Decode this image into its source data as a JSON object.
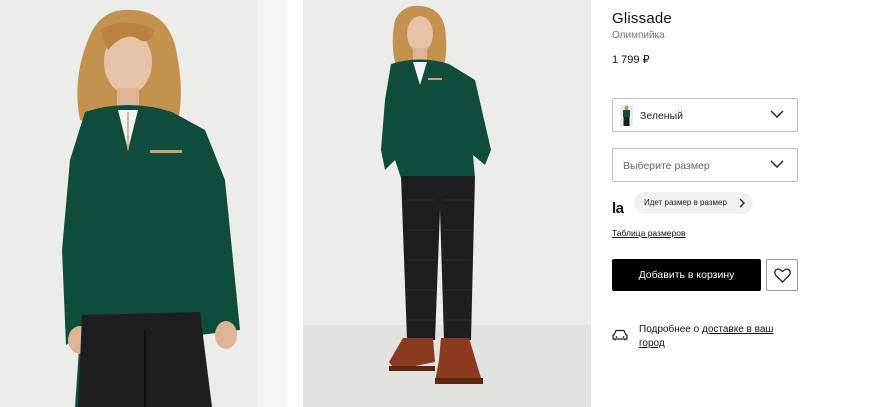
{
  "photos": [
    {
      "alt": "product-photo-front-closeup"
    },
    {
      "alt": "product-photo-full-length"
    }
  ],
  "product": {
    "brand": "Glissade",
    "type": "Олимпийка",
    "price": "1 799 ₽"
  },
  "color_select": {
    "value": "Зеленый"
  },
  "size_select": {
    "placeholder": "Выберите размер"
  },
  "fit": {
    "logo": "la",
    "label": "Идет размер в размер"
  },
  "size_table_link": "Таблица размеров",
  "cart_button": "Добавить в корзину",
  "delivery": {
    "prefix": "Подробнее о ",
    "link": "доставке в ваш город"
  },
  "colors": {
    "jacket_green": "#0f4c3c",
    "pants_black": "#1e1e20",
    "boots_brown": "#8a3a1e",
    "backdrop": "#e9e9e7"
  }
}
